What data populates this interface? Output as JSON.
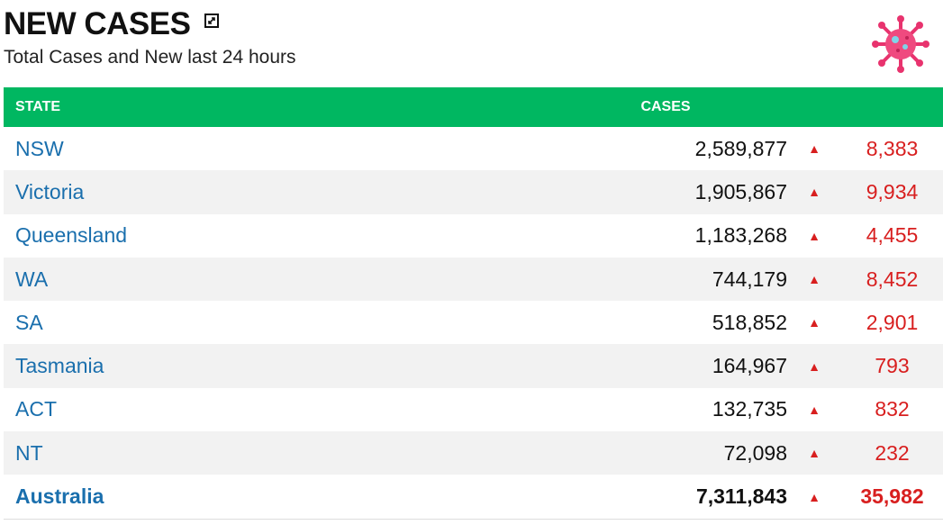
{
  "header": {
    "title": "NEW CASES",
    "subtitle": "Total Cases and New last 24 hours",
    "expand_icon": "expand-icon",
    "virus_icon": "virus-icon"
  },
  "colors": {
    "header_bg": "#00b761",
    "state_text": "#1a6fad",
    "new_cases": "#d81f1f",
    "row_alt": "#f2f2f2"
  },
  "table": {
    "columns": {
      "state": "STATE",
      "cases": "CASES"
    },
    "rows": [
      {
        "state": "NSW",
        "total": "2,589,877",
        "arrow": "▲",
        "new": "8,383"
      },
      {
        "state": "Victoria",
        "total": "1,905,867",
        "arrow": "▲",
        "new": "9,934"
      },
      {
        "state": "Queensland",
        "total": "1,183,268",
        "arrow": "▲",
        "new": "4,455"
      },
      {
        "state": "WA",
        "total": "744,179",
        "arrow": "▲",
        "new": "8,452"
      },
      {
        "state": "SA",
        "total": "518,852",
        "arrow": "▲",
        "new": "2,901"
      },
      {
        "state": "Tasmania",
        "total": "164,967",
        "arrow": "▲",
        "new": "793"
      },
      {
        "state": "ACT",
        "total": "132,735",
        "arrow": "▲",
        "new": "832"
      },
      {
        "state": "NT",
        "total": "72,098",
        "arrow": "▲",
        "new": "232"
      },
      {
        "state": "Australia",
        "total": "7,311,843",
        "arrow": "▲",
        "new": "35,982"
      }
    ]
  }
}
